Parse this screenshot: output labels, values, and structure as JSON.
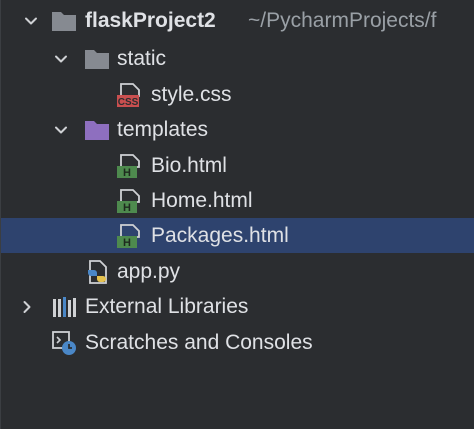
{
  "tree": {
    "root": {
      "name": "flaskProject2",
      "path": "~/PycharmProjects/f",
      "icon": "folder-icon",
      "expanded": true
    },
    "static_folder": {
      "name": "static",
      "icon": "folder-icon",
      "expanded": true
    },
    "style_css": {
      "name": "style.css",
      "icon": "css-file-icon",
      "badge": "CSS"
    },
    "templates_folder": {
      "name": "templates",
      "icon": "templates-folder-icon",
      "expanded": true
    },
    "bio_html": {
      "name": "Bio.html",
      "icon": "html-file-icon",
      "badge": "H"
    },
    "home_html": {
      "name": "Home.html",
      "icon": "html-file-icon",
      "badge": "H"
    },
    "packages_html": {
      "name": "Packages.html",
      "icon": "html-file-icon",
      "badge": "H",
      "selected": true
    },
    "app_py": {
      "name": "app.py",
      "icon": "python-file-icon"
    },
    "external_libraries": {
      "name": "External Libraries",
      "icon": "library-icon",
      "expanded": false
    },
    "scratches": {
      "name": "Scratches and Consoles",
      "icon": "scratches-icon"
    }
  },
  "colors": {
    "background": "#2b2d30",
    "selection": "#2e436e",
    "text": "#dfe1e5",
    "path_text": "#9aa0a6",
    "folder": "#868a91",
    "templates_folder": "#8e6fbf",
    "html_badge": "#4e8a4e",
    "css_badge": "#c94f4f"
  }
}
